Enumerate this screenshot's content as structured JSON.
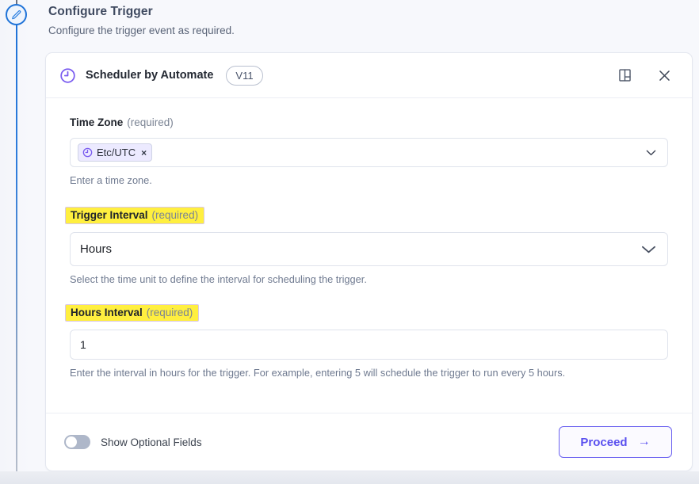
{
  "header": {
    "title": "Configure Trigger",
    "subtitle": "Configure the trigger event as required."
  },
  "rail": {
    "node_icon": "pencil-icon",
    "accent_color": "#1f73d8"
  },
  "card": {
    "app_name": "Scheduler by Automate",
    "app_icon": "clock-icon",
    "version_badge": "V11",
    "header_actions": [
      {
        "name": "docs-icon",
        "label": "Documentation"
      },
      {
        "name": "close-icon",
        "label": "Close"
      }
    ],
    "fields": [
      {
        "label": "Time Zone",
        "required_text": "(required)",
        "highlighted": false,
        "control": "tags",
        "chip": {
          "icon": "clock-icon",
          "text": "Etc/UTC",
          "remove": "×"
        },
        "help": "Enter a time zone."
      },
      {
        "label": "Trigger Interval",
        "required_text": "(required)",
        "highlighted": true,
        "control": "select",
        "value": "Hours",
        "help": "Select the time unit to define the interval for scheduling the trigger."
      },
      {
        "label": "Hours Interval",
        "required_text": "(required)",
        "highlighted": true,
        "control": "text",
        "value": "1",
        "help": "Enter the interval in hours for the trigger. For example, entering 5 will schedule the trigger to run every 5 hours."
      }
    ],
    "footer": {
      "toggle_label": "Show Optional Fields",
      "toggle_state": "off",
      "proceed_label": "Proceed",
      "proceed_arrow": "→"
    }
  },
  "colors": {
    "highlight_yellow": "#ffef3f",
    "accent_purple": "#5a50ef",
    "chip_bg": "#eceaff",
    "rail_blue": "#1f73d8"
  }
}
